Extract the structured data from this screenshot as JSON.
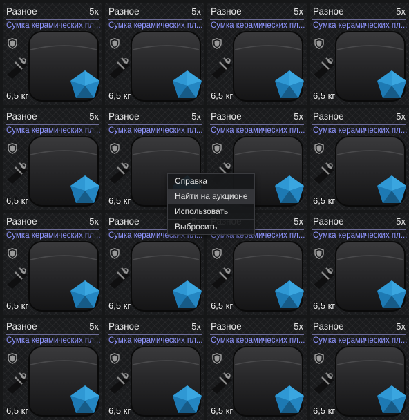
{
  "inventory": {
    "item": {
      "category": "Разное",
      "count": "5x",
      "title": "Сумка керамических пл...",
      "weight": "6,5 кг",
      "icon": "bag-icon",
      "badge_icon": "shield-icon",
      "accent_color": "#8f95ff",
      "badge_color": "#2a8ac4"
    },
    "grid": {
      "rows": 4,
      "cols": 4
    }
  },
  "context_menu": {
    "items": [
      {
        "label": "Справка"
      },
      {
        "label": "Найти на аукционе"
      },
      {
        "label": "Использовать"
      },
      {
        "label": "Выбросить"
      }
    ],
    "hovered_index": 1
  }
}
